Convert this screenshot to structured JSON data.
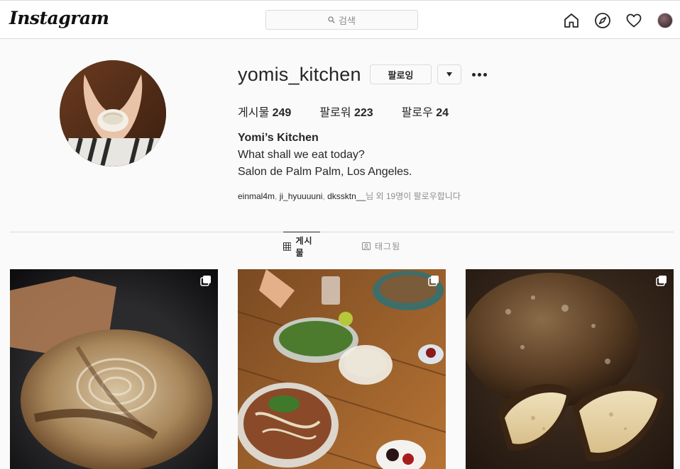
{
  "nav": {
    "logo": "Instagram",
    "search_placeholder": "검색",
    "icons": [
      "home-icon",
      "explore-icon",
      "heart-icon",
      "profile-avatar"
    ]
  },
  "profile": {
    "username": "yomis_kitchen",
    "follow_button": "팔로잉",
    "stats": [
      {
        "label": "게시물",
        "value": "249"
      },
      {
        "label": "팔로워",
        "value": "223"
      },
      {
        "label": "팔로우",
        "value": "24"
      }
    ],
    "full_name": "Yomi’s Kitchen",
    "bio_line1": "What shall we eat today?",
    "bio_line2": "Salon de Palm Palm, Los Angeles.",
    "followed_by": {
      "user1": "einmal4m",
      "sep1": ", ",
      "user2": "ji_hyuuuuni",
      "sep2": ", ",
      "user3": "dkssktn__",
      "suffix": "님 외 19명이 팔로우합니다"
    }
  },
  "tabs": [
    {
      "label": "게시물",
      "icon": "grid-icon",
      "active": true
    },
    {
      "label": "태그됨",
      "icon": "tagged-icon",
      "active": false
    }
  ],
  "posts": [
    {
      "subject": "sourdough loaf in dutch oven",
      "multi": true
    },
    {
      "subject": "pho noodle soup table spread",
      "multi": true
    },
    {
      "subject": "rustic bread loaf cut open",
      "multi": true
    }
  ],
  "colors": {
    "border": "#dbdbdb",
    "text": "#262626",
    "muted": "#8e8e8e",
    "background": "#fafafa"
  }
}
